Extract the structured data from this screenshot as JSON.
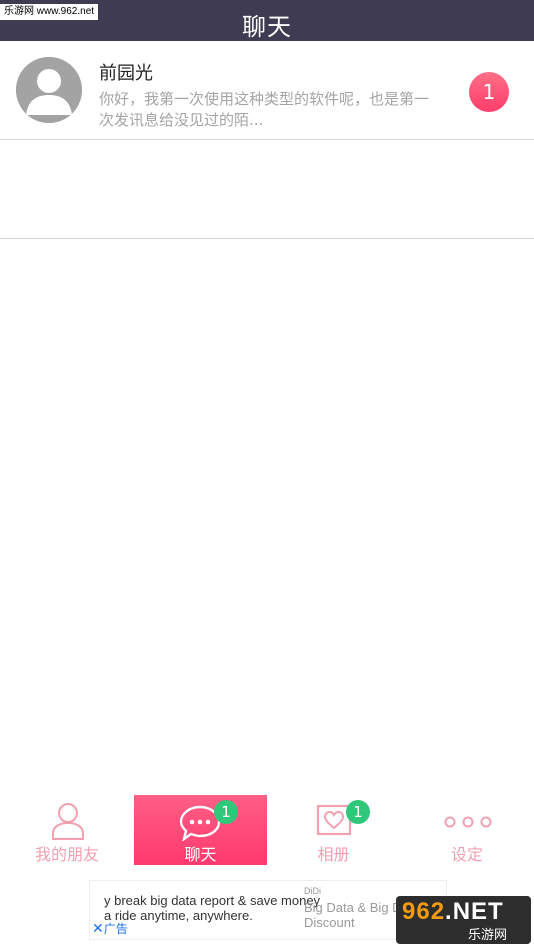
{
  "header": {
    "title": "聊天",
    "watermark": "乐游网 www.962.net"
  },
  "conversations": [
    {
      "name": "前园光",
      "preview": "你好，我第一次使用这种类型的软件呢，也是第一次发讯息给没见过的陌...",
      "unread": "1"
    }
  ],
  "tabs": [
    {
      "label": "我的朋友",
      "icon": "person-icon",
      "badge": ""
    },
    {
      "label": "聊天",
      "icon": "chat-bubble-icon",
      "badge": "1",
      "active": true
    },
    {
      "label": "相册",
      "icon": "photo-heart-icon",
      "badge": "1"
    },
    {
      "label": "设定",
      "icon": "more-dots-icon",
      "badge": ""
    }
  ],
  "ad": {
    "line1": "y break big data report & save money",
    "line2": "a ride anytime, anywhere.",
    "brand": "DiDi",
    "title": "Big Data & Big D",
    "subtitle": "Discount",
    "close_label": "广告"
  },
  "site_logo": {
    "main": "962",
    "net": ".NET",
    "sub": "乐游网"
  },
  "colors": {
    "header_bg": "#3f3b52",
    "accent_pink": "#ff4a78",
    "badge_green": "#2fc77a",
    "tab_inactive": "#f2a0b0"
  }
}
